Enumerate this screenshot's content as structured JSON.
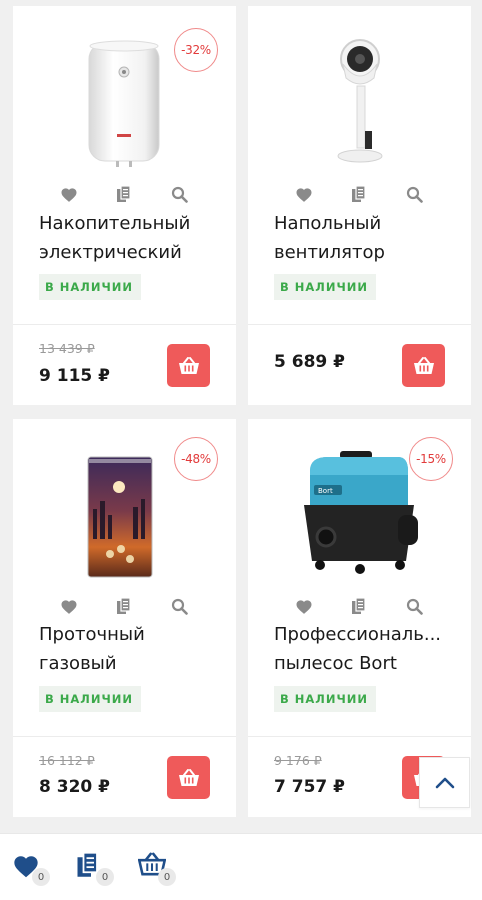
{
  "colors": {
    "accent": "#ef5a5a",
    "in_stock_text": "#3ba94a",
    "in_stock_bg": "#eef3ee",
    "icon_gray": "#8a8a8a",
    "brand_blue": "#1f4e8a"
  },
  "products": [
    {
      "title_line1": "Накопительный",
      "title_line2": "электрический",
      "discount": "-32%",
      "stock": "В НАЛИЧИИ",
      "old_price": "13 439 ₽",
      "price": "9 115 ₽",
      "image": "water-heater-image"
    },
    {
      "title_line1": "Напольный",
      "title_line2": "вентилятор",
      "discount": "",
      "stock": "В НАЛИЧИИ",
      "old_price": "",
      "price": "5 689 ₽",
      "image": "floor-fan-image"
    },
    {
      "title_line1": "Проточный",
      "title_line2": "газовый",
      "discount": "-48%",
      "stock": "В НАЛИЧИИ",
      "old_price": "16 112 ₽",
      "price": "8 320 ₽",
      "image": "gas-water-heater-image"
    },
    {
      "title_line1": "Профессиональ...",
      "title_line2": "пылесос Bort",
      "discount": "-15%",
      "stock": "В НАЛИЧИИ",
      "old_price": "9 176 ₽",
      "price": "7 757 ₽",
      "image": "vacuum-cleaner-image"
    }
  ],
  "bottom_bar": {
    "favorites_count": "0",
    "compare_count": "0",
    "basket_count": "0"
  }
}
